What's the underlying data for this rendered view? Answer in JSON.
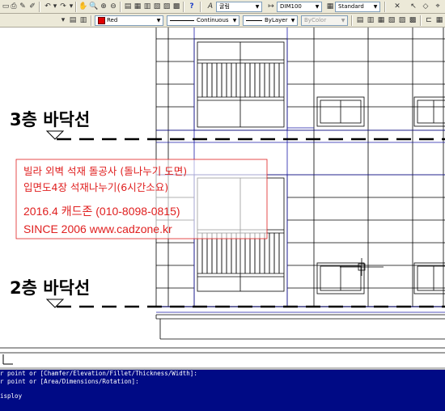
{
  "toolbar": {
    "text_style_value": "굴림",
    "dim_style_value": "DIM100",
    "table_style_value": "Standard",
    "color_value": "Red",
    "linetype_value": "Continuous",
    "lineweight_value": "ByLayer",
    "plotstyle_value": "ByColor"
  },
  "drawing": {
    "floor_label_3": "3층 바닥선",
    "floor_label_2": "2층 바닥선",
    "watermark": {
      "line1": "빌라 외벽 석재 돌공사 (돌나누기 도면)",
      "line2": "입면도4장 석재나누기(6시간소요)",
      "line3": "2016.4 캐드존 (010-8098-0815)",
      "line4": "SINCE 2006 www.cadzone.kr"
    },
    "colors": {
      "grid": "#1a1aa8",
      "watermark": "#e02020",
      "linework": "#000000"
    }
  },
  "command": {
    "line1": "r point or [Chamfer/Elevation/Fillet/Thickness/Width]:",
    "line2": "r point or [Area/Dimensions/Rotation]:",
    "line3": "isploy",
    "background": "#000a85"
  }
}
